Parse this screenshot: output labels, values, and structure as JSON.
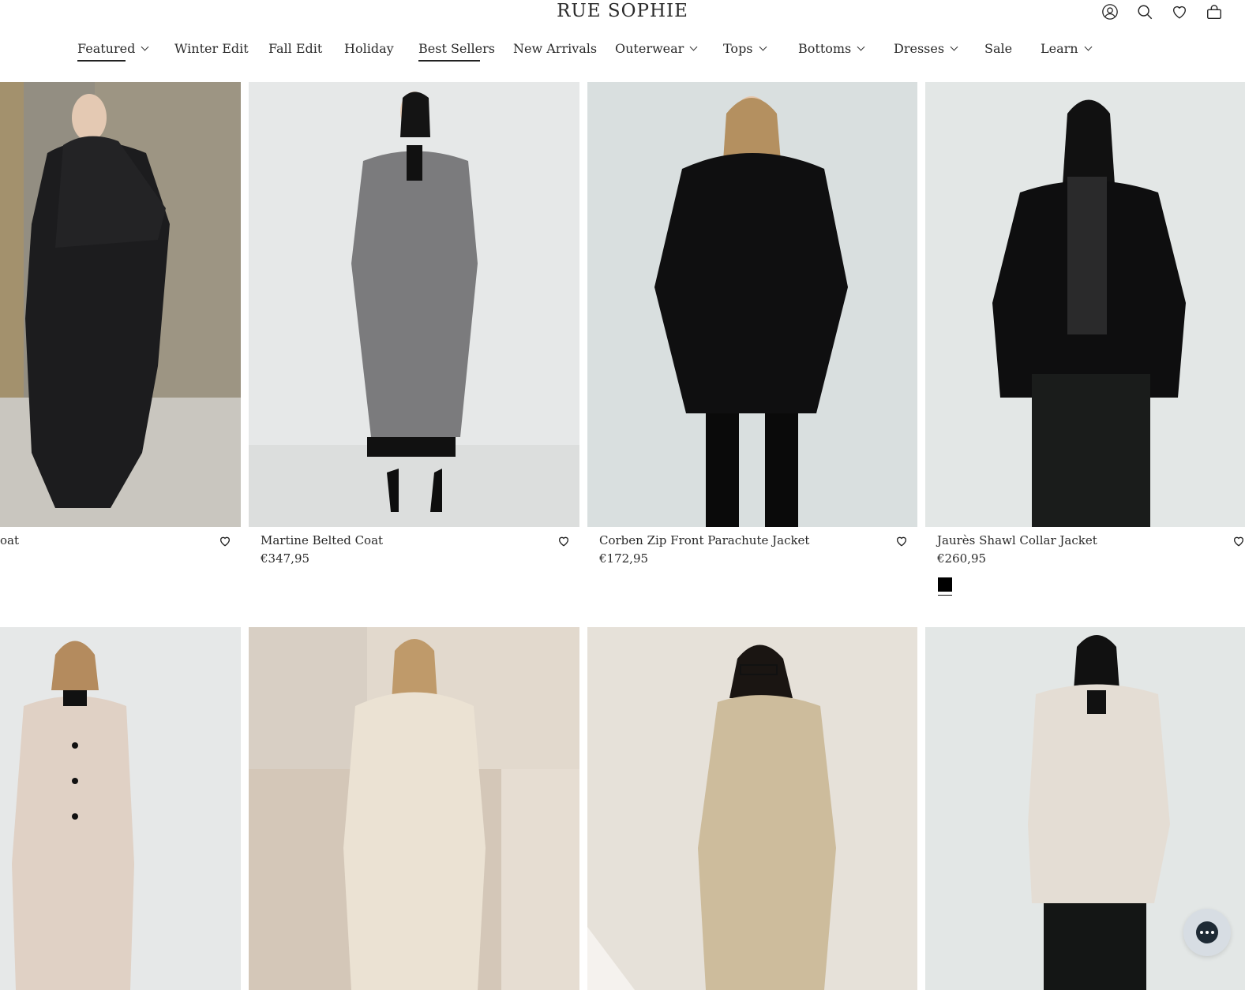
{
  "brand": {
    "logo_text": "RUE SOPHIE"
  },
  "header_icons": [
    "account-icon",
    "search-icon",
    "wishlist-heart-icon",
    "cart-bag-icon"
  ],
  "nav": {
    "items": [
      {
        "label": "Featured",
        "has_dropdown": true,
        "underlined": true
      },
      {
        "label": "Winter Edit",
        "has_dropdown": false
      },
      {
        "label": "Fall Edit",
        "has_dropdown": false
      },
      {
        "label": "Holiday",
        "has_dropdown": false
      },
      {
        "label": "Best Sellers",
        "has_dropdown": false,
        "underlined": true
      },
      {
        "label": "New Arrivals",
        "has_dropdown": false
      },
      {
        "label": "Outerwear",
        "has_dropdown": true
      },
      {
        "label": "Tops",
        "has_dropdown": true
      },
      {
        "label": "Bottoms",
        "has_dropdown": true
      },
      {
        "label": "Dresses",
        "has_dropdown": true
      },
      {
        "label": "Sale",
        "has_dropdown": false
      },
      {
        "label": "Learn",
        "has_dropdown": true
      }
    ]
  },
  "products": [
    {
      "title": "oat",
      "price": ""
    },
    {
      "title": "Martine Belted Coat",
      "price": "€347,95"
    },
    {
      "title": "Corben Zip Front Parachute Jacket",
      "price": "€172,95"
    },
    {
      "title": "Jaurès Shawl Collar Jacket",
      "price": "€260,95",
      "swatch_color": "#000000"
    },
    {
      "title": "",
      "price": ""
    },
    {
      "title": "",
      "price": ""
    },
    {
      "title": "",
      "price": ""
    },
    {
      "title": "",
      "price": ""
    }
  ],
  "colors": {
    "text": "#2a2a2a",
    "background": "#ffffff",
    "chat_button": "#d7dde3"
  }
}
